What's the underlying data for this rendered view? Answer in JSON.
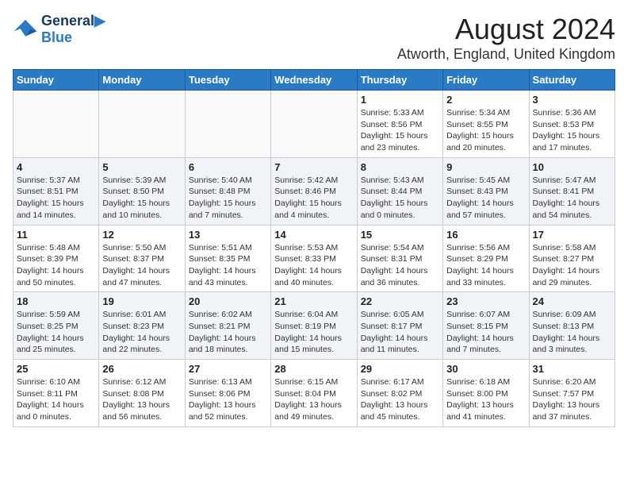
{
  "logo": {
    "line1": "General",
    "line2": "Blue"
  },
  "title": "August 2024",
  "subtitle": "Atworth, England, United Kingdom",
  "days_of_week": [
    "Sunday",
    "Monday",
    "Tuesday",
    "Wednesday",
    "Thursday",
    "Friday",
    "Saturday"
  ],
  "weeks": [
    [
      {
        "date": "",
        "info": ""
      },
      {
        "date": "",
        "info": ""
      },
      {
        "date": "",
        "info": ""
      },
      {
        "date": "",
        "info": ""
      },
      {
        "date": "1",
        "info": "Sunrise: 5:33 AM\nSunset: 8:56 PM\nDaylight: 15 hours\nand 23 minutes."
      },
      {
        "date": "2",
        "info": "Sunrise: 5:34 AM\nSunset: 8:55 PM\nDaylight: 15 hours\nand 20 minutes."
      },
      {
        "date": "3",
        "info": "Sunrise: 5:36 AM\nSunset: 8:53 PM\nDaylight: 15 hours\nand 17 minutes."
      }
    ],
    [
      {
        "date": "4",
        "info": "Sunrise: 5:37 AM\nSunset: 8:51 PM\nDaylight: 15 hours\nand 14 minutes."
      },
      {
        "date": "5",
        "info": "Sunrise: 5:39 AM\nSunset: 8:50 PM\nDaylight: 15 hours\nand 10 minutes."
      },
      {
        "date": "6",
        "info": "Sunrise: 5:40 AM\nSunset: 8:48 PM\nDaylight: 15 hours\nand 7 minutes."
      },
      {
        "date": "7",
        "info": "Sunrise: 5:42 AM\nSunset: 8:46 PM\nDaylight: 15 hours\nand 4 minutes."
      },
      {
        "date": "8",
        "info": "Sunrise: 5:43 AM\nSunset: 8:44 PM\nDaylight: 15 hours\nand 0 minutes."
      },
      {
        "date": "9",
        "info": "Sunrise: 5:45 AM\nSunset: 8:43 PM\nDaylight: 14 hours\nand 57 minutes."
      },
      {
        "date": "10",
        "info": "Sunrise: 5:47 AM\nSunset: 8:41 PM\nDaylight: 14 hours\nand 54 minutes."
      }
    ],
    [
      {
        "date": "11",
        "info": "Sunrise: 5:48 AM\nSunset: 8:39 PM\nDaylight: 14 hours\nand 50 minutes."
      },
      {
        "date": "12",
        "info": "Sunrise: 5:50 AM\nSunset: 8:37 PM\nDaylight: 14 hours\nand 47 minutes."
      },
      {
        "date": "13",
        "info": "Sunrise: 5:51 AM\nSunset: 8:35 PM\nDaylight: 14 hours\nand 43 minutes."
      },
      {
        "date": "14",
        "info": "Sunrise: 5:53 AM\nSunset: 8:33 PM\nDaylight: 14 hours\nand 40 minutes."
      },
      {
        "date": "15",
        "info": "Sunrise: 5:54 AM\nSunset: 8:31 PM\nDaylight: 14 hours\nand 36 minutes."
      },
      {
        "date": "16",
        "info": "Sunrise: 5:56 AM\nSunset: 8:29 PM\nDaylight: 14 hours\nand 33 minutes."
      },
      {
        "date": "17",
        "info": "Sunrise: 5:58 AM\nSunset: 8:27 PM\nDaylight: 14 hours\nand 29 minutes."
      }
    ],
    [
      {
        "date": "18",
        "info": "Sunrise: 5:59 AM\nSunset: 8:25 PM\nDaylight: 14 hours\nand 25 minutes."
      },
      {
        "date": "19",
        "info": "Sunrise: 6:01 AM\nSunset: 8:23 PM\nDaylight: 14 hours\nand 22 minutes."
      },
      {
        "date": "20",
        "info": "Sunrise: 6:02 AM\nSunset: 8:21 PM\nDaylight: 14 hours\nand 18 minutes."
      },
      {
        "date": "21",
        "info": "Sunrise: 6:04 AM\nSunset: 8:19 PM\nDaylight: 14 hours\nand 15 minutes."
      },
      {
        "date": "22",
        "info": "Sunrise: 6:05 AM\nSunset: 8:17 PM\nDaylight: 14 hours\nand 11 minutes."
      },
      {
        "date": "23",
        "info": "Sunrise: 6:07 AM\nSunset: 8:15 PM\nDaylight: 14 hours\nand 7 minutes."
      },
      {
        "date": "24",
        "info": "Sunrise: 6:09 AM\nSunset: 8:13 PM\nDaylight: 14 hours\nand 3 minutes."
      }
    ],
    [
      {
        "date": "25",
        "info": "Sunrise: 6:10 AM\nSunset: 8:11 PM\nDaylight: 14 hours\nand 0 minutes."
      },
      {
        "date": "26",
        "info": "Sunrise: 6:12 AM\nSunset: 8:08 PM\nDaylight: 13 hours\nand 56 minutes."
      },
      {
        "date": "27",
        "info": "Sunrise: 6:13 AM\nSunset: 8:06 PM\nDaylight: 13 hours\nand 52 minutes."
      },
      {
        "date": "28",
        "info": "Sunrise: 6:15 AM\nSunset: 8:04 PM\nDaylight: 13 hours\nand 49 minutes."
      },
      {
        "date": "29",
        "info": "Sunrise: 6:17 AM\nSunset: 8:02 PM\nDaylight: 13 hours\nand 45 minutes."
      },
      {
        "date": "30",
        "info": "Sunrise: 6:18 AM\nSunset: 8:00 PM\nDaylight: 13 hours\nand 41 minutes."
      },
      {
        "date": "31",
        "info": "Sunrise: 6:20 AM\nSunset: 7:57 PM\nDaylight: 13 hours\nand 37 minutes."
      }
    ]
  ]
}
